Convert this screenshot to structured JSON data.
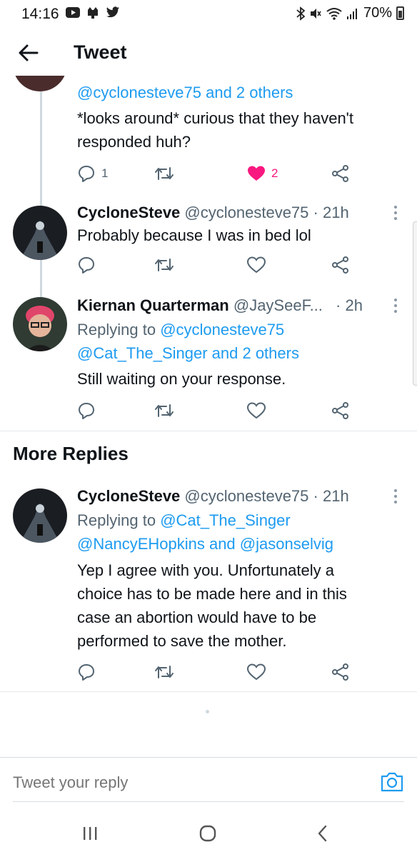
{
  "status_bar": {
    "time": "14:16",
    "battery": "70%"
  },
  "header": {
    "title": "Tweet"
  },
  "tweets": [
    {
      "mentions_line": "@cyclonesteve75 and 2 others",
      "text_line1": "*looks around* curious that they haven't",
      "text_line2": "responded huh?",
      "reply_count": "1",
      "like_count": "2",
      "liked": true
    },
    {
      "name": "CycloneSteve",
      "handle": "@cyclonesteve75",
      "time": "· 21h",
      "text": "Probably because I was in bed lol"
    },
    {
      "name": "Kiernan Quarterman",
      "handle": "@JaySeeF...",
      "time": "· 2h",
      "replying_prefix": "Replying to ",
      "replying_to1": "@cyclonesteve75",
      "replying_to2": "@Cat_The_Singer and 2 others",
      "text": "Still waiting on your response."
    }
  ],
  "more_replies": {
    "title": "More Replies",
    "tweet": {
      "name": "CycloneSteve",
      "handle": "@cyclonesteve75",
      "time": "· 21h",
      "replying_prefix": "Replying to ",
      "replying_to1": "@Cat_The_Singer",
      "replying_to2": "@NancyEHopkins and @jasonselvig",
      "text_line1": "Yep I agree with you. Unfortunately a",
      "text_line2": "choice has to be made here and in this",
      "text_line3": "case an abortion would have to be",
      "text_line4": "performed to save the mother."
    }
  },
  "reply_bar": {
    "placeholder": "Tweet your reply"
  },
  "colors": {
    "accent": "#1d9bf0",
    "like": "#f91880",
    "secondary_text": "#536471"
  },
  "icons": [
    "back-arrow-icon",
    "reply-icon",
    "retweet-icon",
    "heart-icon",
    "share-icon",
    "more-icon",
    "camera-icon",
    "recent-apps-icon",
    "home-icon",
    "back-nav-icon"
  ]
}
